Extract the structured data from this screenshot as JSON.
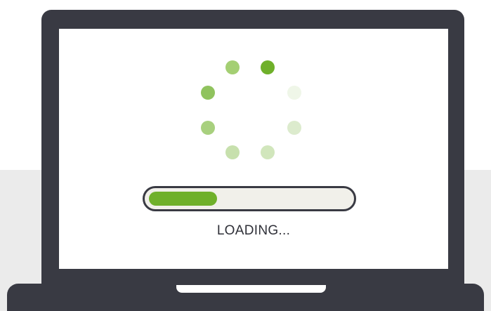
{
  "loading_label": "LOADING...",
  "progress": 0.34,
  "colors": {
    "device": "#393a43",
    "screen": "#ffffff",
    "backdrop": "#ebebeb",
    "track": "#f1f0ea",
    "accent": "#6fb02a",
    "text": "#2f3038"
  },
  "spinner": {
    "dot_count": 8,
    "dot_colors": [
      "#6fb02a",
      "#eff6e8",
      "#dcebcd",
      "#d1e6bc",
      "#c7e0ad",
      "#a8d07e",
      "#90c35e",
      "#a4cf73"
    ]
  }
}
